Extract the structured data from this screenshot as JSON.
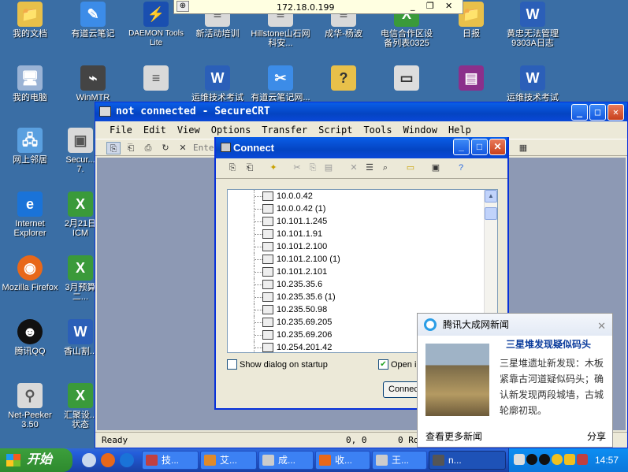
{
  "remote_bar": {
    "host": "172.18.0.199",
    "minimize": "_",
    "restore": "❐",
    "close": "✕"
  },
  "desktop_icons": [
    {
      "label": "我的文档",
      "color": "#e8c04a"
    },
    {
      "label": "有道云笔记",
      "color": "#3c8ce8"
    },
    {
      "label": "DAEMON Tools Lite",
      "color": "#1a4fb0"
    },
    {
      "label": "新活动培训",
      "color": "#d9d9d9"
    },
    {
      "label": "Hillstone山石网科安...",
      "color": "#d9d9d9"
    },
    {
      "label": "成华-杨波",
      "color": "#d9d9d9"
    },
    {
      "label": "电信合作区设备列表0325",
      "color": "#3a9a3a"
    },
    {
      "label": "日报",
      "color": "#e8c04a"
    },
    {
      "label": "黄忠无法管理9303A日志",
      "color": "#2b5fb8"
    },
    {
      "label": "我的电脑",
      "color": "#9ab3d5"
    },
    {
      "label": "WinMTR",
      "color": "#444"
    },
    {
      "label": "",
      "color": "#d9d9d9"
    },
    {
      "label": "运维技术考试",
      "color": "#2b5fb8"
    },
    {
      "label": "有道云笔记网...",
      "color": "#3c8ce8"
    },
    {
      "label": "",
      "color": "#e8c04a"
    },
    {
      "label": "",
      "color": "#ddd"
    },
    {
      "label": "",
      "color": "#8b2f8b"
    },
    {
      "label": "运维技术考试",
      "color": "#2b5fb8"
    },
    {
      "label": "网上邻居",
      "color": "#5aa0e0"
    },
    {
      "label": "Secur... 7.",
      "color": "#d9d9d9"
    },
    {
      "label": "Internet Explorer",
      "color": "#1a73d8"
    },
    {
      "label": "2月21日 ICM",
      "color": "#3a9a3a"
    },
    {
      "label": "Mozilla Firefox",
      "color": "#e8681a"
    },
    {
      "label": "3月预算 二...",
      "color": "#3a9a3a"
    },
    {
      "label": "腾讯QQ",
      "color": "#111"
    },
    {
      "label": "香山割...",
      "color": "#2b5fb8"
    },
    {
      "label": "Net-Peeker 3.50",
      "color": "#d9d9d9"
    },
    {
      "label": "汇聚设... 状态",
      "color": "#3a9a3a"
    }
  ],
  "securecrt": {
    "title": "not connected - SecureCRT",
    "menu": [
      "File",
      "Edit",
      "View",
      "Options",
      "Transfer",
      "Script",
      "Tools",
      "Window",
      "Help"
    ],
    "enter_hint": "Enter",
    "status_ready": "Ready",
    "status_pos": "0, 0",
    "status_rows": "0 Rows"
  },
  "connect_dialog": {
    "title": "Connect",
    "sessions": [
      "10.0.0.42",
      "10.0.0.42 (1)",
      "10.101.1.245",
      "10.101.1.91",
      "10.101.2.100",
      "10.101.2.100 (1)",
      "10.101.2.101",
      "10.235.35.6",
      "10.235.35.6 (1)",
      "10.235.50.98",
      "10.235.69.205",
      "10.235.69.206",
      "10.254.201.42"
    ],
    "show_dialog_label": "Show dialog on startup",
    "show_dialog_checked": false,
    "open_in_label": "Open in",
    "open_in_checked": true,
    "connect_label": "Connect"
  },
  "news_popup": {
    "app_name": "腾讯大成网新闻",
    "headline": "三星堆发现疑似码头",
    "body": "三星堆遗址新发现：木板紧靠古河道疑似码头；确认新发现两段城墙，古城轮廓初现。",
    "more": "查看更多新闻",
    "share": "分享",
    "close": "✕"
  },
  "taskbar": {
    "start_label": "开始",
    "tasks": [
      {
        "label": "技...",
        "color": "#c04040"
      },
      {
        "label": "艾...",
        "color": "#e08a2a"
      },
      {
        "label": "成...",
        "color": "#ccc"
      },
      {
        "label": "收...",
        "color": "#e8681a"
      },
      {
        "label": "王...",
        "color": "#ccc"
      },
      {
        "label": "n...",
        "color": "#555"
      }
    ],
    "clock": "14:57"
  }
}
